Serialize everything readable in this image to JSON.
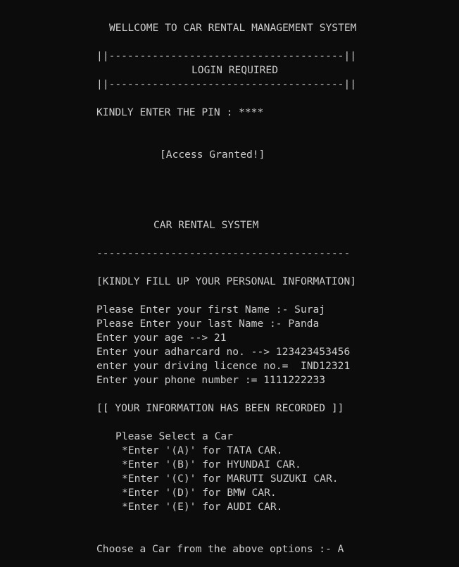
{
  "login": {
    "welcome": "WELLCOME TO CAR RENTAL MANAGEMENT SYSTEM",
    "border_top": "||--------------------------------------||",
    "login_required": "LOGIN REQUIRED",
    "border_bottom": "||--------------------------------------||",
    "pin_prompt": "KINDLY ENTER THE PIN : ****",
    "access_granted": "[Access Granted!]"
  },
  "system": {
    "title": "CAR RENTAL SYSTEM",
    "divider": "-----------------------------------------",
    "fill_info": "[KINDLY FILL UP YOUR PERSONAL INFORMATION]"
  },
  "personal_info": [
    "Please Enter your first Name :- Suraj",
    "Please Enter your last Name :- Panda",
    "Enter your age --> 21",
    "Enter your adharcard no. --> 123423453456",
    "enter your driving licence no.=  IND12321",
    "Enter your phone number := 1111222233"
  ],
  "recorded": "[[ YOUR INFORMATION HAS BEEN RECORDED ]]",
  "car_menu": {
    "heading": "Please Select a Car",
    "options": [
      "*Enter '(A)' for TATA CAR.",
      "*Enter '(B)' for HYUNDAI CAR.",
      "*Enter '(C)' for MARUTI SUZUKI CAR.",
      "*Enter '(D)' for BMW CAR.",
      "*Enter '(E)' for AUDI CAR."
    ]
  },
  "choose_prompt": "Choose a Car from the above options :- A",
  "colors": {
    "background": "#0c0c0c",
    "text": "#cccccc"
  }
}
